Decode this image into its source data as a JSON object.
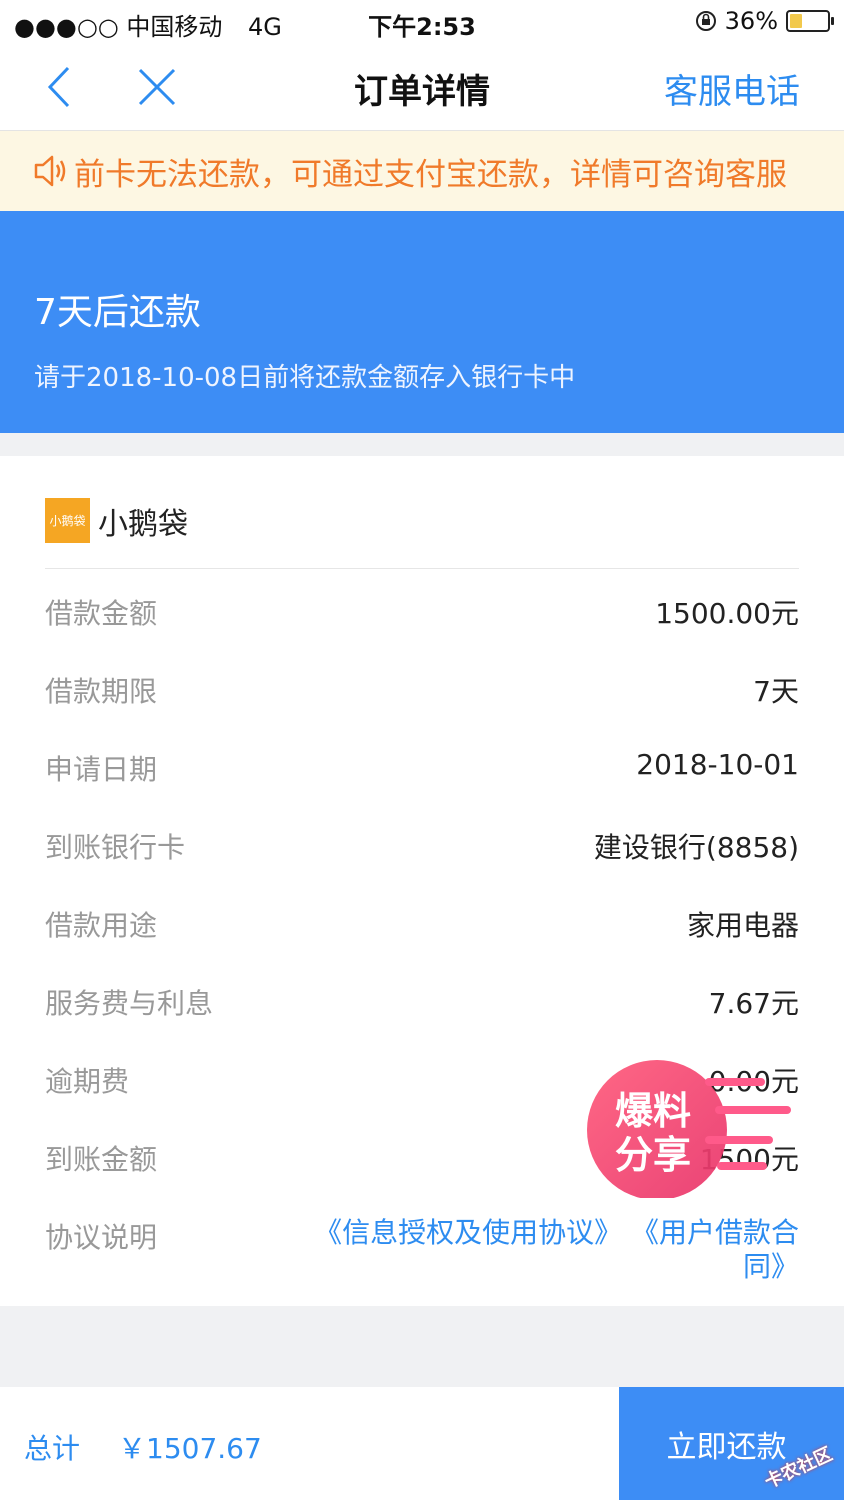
{
  "status_bar": {
    "carrier": "●●●○○ 中国移动",
    "network": "4G",
    "time": "下午2:53",
    "battery": "36%",
    "battery_level": 0.36
  },
  "nav": {
    "title": "订单详情",
    "service_phone": "客服电话"
  },
  "notice": {
    "text": "前卡无法还款，可通过支付宝还款，详情可咨询客服"
  },
  "banner": {
    "headline": "7天后还款",
    "subtitle": "请于2018-10-08日前将还款金额存入银行卡中"
  },
  "lender": {
    "logo_text": "小鹅袋",
    "name": "小鹅袋"
  },
  "details": [
    {
      "label": "借款金额",
      "value": "1500.00元"
    },
    {
      "label": "借款期限",
      "value": "7天"
    },
    {
      "label": "申请日期",
      "value": "2018-10-01"
    },
    {
      "label": "到账银行卡",
      "value": "建设银行(8858)"
    },
    {
      "label": "借款用途",
      "value": "家用电器"
    },
    {
      "label": "服务费与利息",
      "value": "7.67元"
    },
    {
      "label": "逾期费",
      "value": "0.00元"
    },
    {
      "label": "到账金额",
      "value": "1500元"
    }
  ],
  "agreement": {
    "label": "协议说明",
    "link1": "《信息授权及使用协议》",
    "link2": "《用户借款合同》"
  },
  "watermark": {
    "line1": "爆料",
    "line2": "分享"
  },
  "footer": {
    "total_label": "总计",
    "total_value": "￥1507.67",
    "pay_button": "立即还款",
    "corner_stamp": "卡农社区"
  },
  "colors": {
    "primary": "#3d8df5",
    "link": "#2d8cf0",
    "notice_text": "#f07a2a",
    "notice_bg": "#fdf7e3",
    "logo": "#f5a623"
  }
}
